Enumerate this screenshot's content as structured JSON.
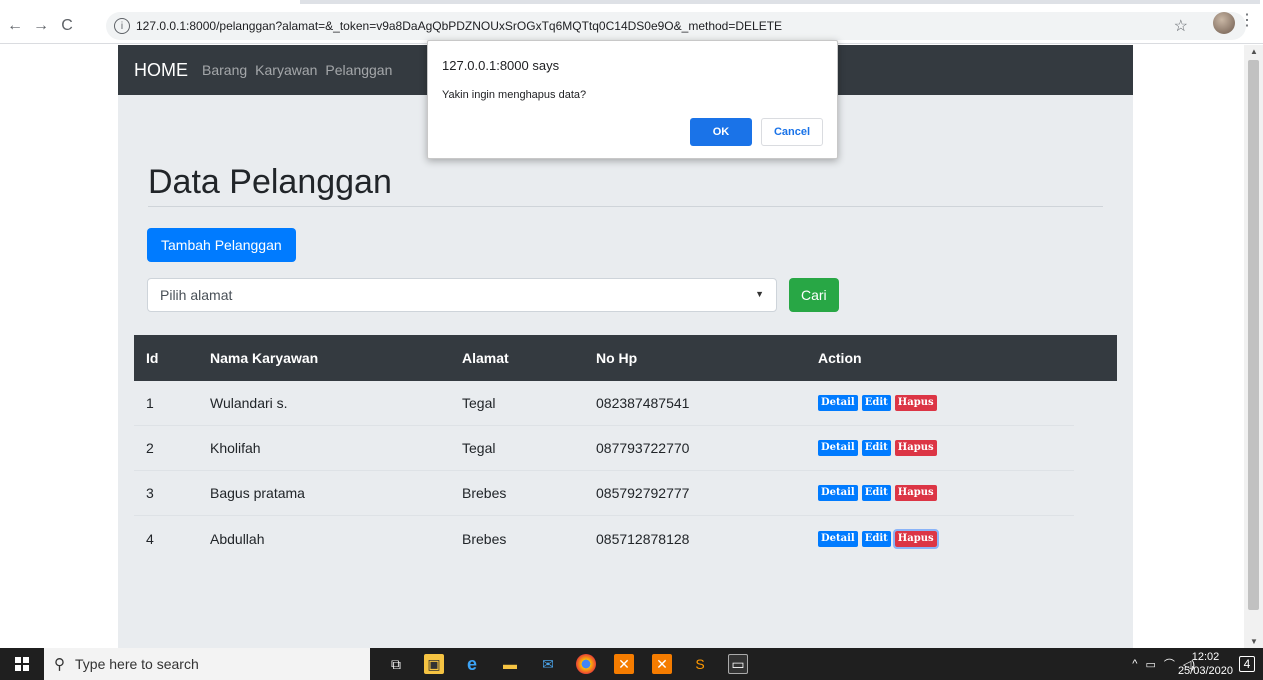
{
  "browser": {
    "url": "127.0.0.1:8000/pelanggan?alamat=&_token=v9a8DaAgQbPDZNOUxSrOGxTq6MQTtq0C14DS0e9O&_method=DELETE"
  },
  "navbar": {
    "brand": "HOME",
    "links": [
      "Barang",
      "Karyawan",
      "Pelanggan"
    ]
  },
  "page": {
    "title": "Data Pelanggan",
    "add_button": "Tambah Pelanggan",
    "select_placeholder": "Pilih alamat",
    "search_button": "Cari"
  },
  "table": {
    "headers": [
      "Id",
      "Nama Karyawan",
      "Alamat",
      "No Hp",
      "Action"
    ],
    "rows": [
      {
        "id": "1",
        "nama": "Wulandari s.",
        "alamat": "Tegal",
        "hp": "082387487541"
      },
      {
        "id": "2",
        "nama": "Kholifah",
        "alamat": "Tegal",
        "hp": "087793722770"
      },
      {
        "id": "3",
        "nama": "Bagus pratama",
        "alamat": "Brebes",
        "hp": "085792792777"
      },
      {
        "id": "4",
        "nama": "Abdullah",
        "alamat": "Brebes",
        "hp": "085712878128"
      }
    ],
    "actions": {
      "detail": "Detail",
      "edit": "Edit",
      "hapus": "Hapus"
    }
  },
  "dialog": {
    "origin": "127.0.0.1:8000 says",
    "message": "Yakin ingin menghapus data?",
    "ok": "OK",
    "cancel": "Cancel"
  },
  "taskbar": {
    "search_placeholder": "Type here to search",
    "time": "12:02",
    "date": "25/03/2020",
    "notification_count": "4"
  },
  "colors": {
    "primary": "#007bff",
    "success": "#28a745",
    "danger": "#dc3545",
    "dark": "#343a40",
    "jumbotron": "#e9ecef"
  }
}
